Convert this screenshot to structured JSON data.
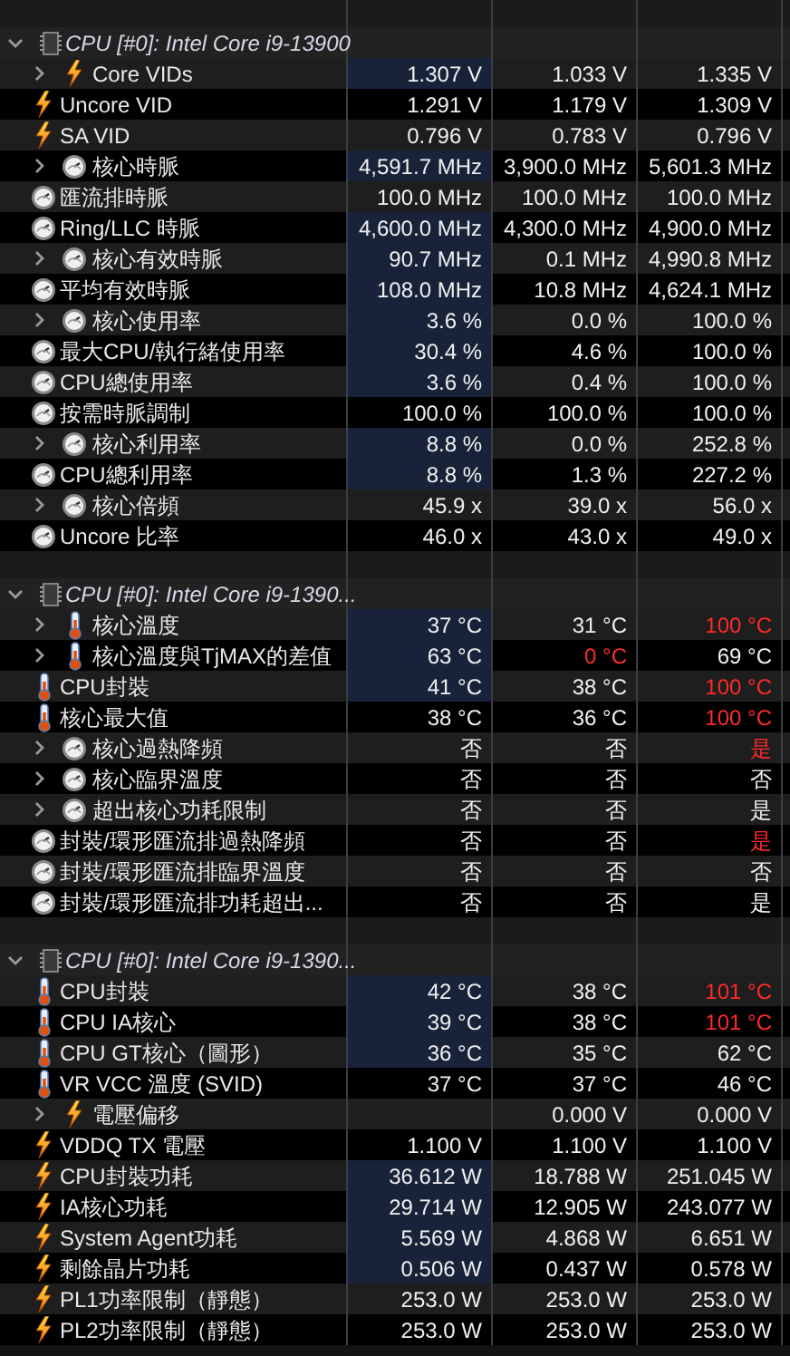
{
  "sections": [
    {
      "title": "CPU [#0]: Intel Core i9-13900",
      "expanded": true,
      "rows": [
        {
          "kind": "voltage",
          "label": "Core VIDs",
          "expandable": true,
          "highlighted": true,
          "current": {
            "text": "1.307 V",
            "alert": false
          },
          "minimum": {
            "text": "1.033 V",
            "alert": false
          },
          "maximum": {
            "text": "1.335 V",
            "alert": false
          }
        },
        {
          "kind": "voltage",
          "label": "Uncore VID",
          "expandable": false,
          "highlighted": false,
          "current": {
            "text": "1.291 V",
            "alert": false
          },
          "minimum": {
            "text": "1.179 V",
            "alert": false
          },
          "maximum": {
            "text": "1.309 V",
            "alert": false
          }
        },
        {
          "kind": "voltage",
          "label": "SA VID",
          "expandable": false,
          "highlighted": false,
          "current": {
            "text": "0.796 V",
            "alert": false
          },
          "minimum": {
            "text": "0.783 V",
            "alert": false
          },
          "maximum": {
            "text": "0.796 V",
            "alert": false
          }
        },
        {
          "kind": "clock",
          "label": "核心時脈",
          "expandable": true,
          "highlighted": true,
          "current": {
            "text": "4,591.7 MHz",
            "alert": false
          },
          "minimum": {
            "text": "3,900.0 MHz",
            "alert": false
          },
          "maximum": {
            "text": "5,601.3 MHz",
            "alert": false
          }
        },
        {
          "kind": "clock",
          "label": "匯流排時脈",
          "expandable": false,
          "highlighted": false,
          "current": {
            "text": "100.0 MHz",
            "alert": false
          },
          "minimum": {
            "text": "100.0 MHz",
            "alert": false
          },
          "maximum": {
            "text": "100.0 MHz",
            "alert": false
          }
        },
        {
          "kind": "clock",
          "label": "Ring/LLC 時脈",
          "expandable": false,
          "highlighted": true,
          "current": {
            "text": "4,600.0 MHz",
            "alert": false
          },
          "minimum": {
            "text": "4,300.0 MHz",
            "alert": false
          },
          "maximum": {
            "text": "4,900.0 MHz",
            "alert": false
          }
        },
        {
          "kind": "clock",
          "label": "核心有效時脈",
          "expandable": true,
          "highlighted": true,
          "current": {
            "text": "90.7 MHz",
            "alert": false
          },
          "minimum": {
            "text": "0.1 MHz",
            "alert": false
          },
          "maximum": {
            "text": "4,990.8 MHz",
            "alert": false
          }
        },
        {
          "kind": "clock",
          "label": "平均有效時脈",
          "expandable": false,
          "highlighted": true,
          "current": {
            "text": "108.0 MHz",
            "alert": false
          },
          "minimum": {
            "text": "10.8 MHz",
            "alert": false
          },
          "maximum": {
            "text": "4,624.1 MHz",
            "alert": false
          }
        },
        {
          "kind": "clock",
          "label": "核心使用率",
          "expandable": true,
          "highlighted": true,
          "current": {
            "text": "3.6 %",
            "alert": false
          },
          "minimum": {
            "text": "0.0 %",
            "alert": false
          },
          "maximum": {
            "text": "100.0 %",
            "alert": false
          }
        },
        {
          "kind": "clock",
          "label": "最大CPU/執行緒使用率",
          "expandable": false,
          "highlighted": true,
          "current": {
            "text": "30.4 %",
            "alert": false
          },
          "minimum": {
            "text": "4.6 %",
            "alert": false
          },
          "maximum": {
            "text": "100.0 %",
            "alert": false
          }
        },
        {
          "kind": "clock",
          "label": "CPU總使用率",
          "expandable": false,
          "highlighted": true,
          "current": {
            "text": "3.6 %",
            "alert": false
          },
          "minimum": {
            "text": "0.4 %",
            "alert": false
          },
          "maximum": {
            "text": "100.0 %",
            "alert": false
          }
        },
        {
          "kind": "clock",
          "label": "按需時脈調制",
          "expandable": false,
          "highlighted": false,
          "current": {
            "text": "100.0 %",
            "alert": false
          },
          "minimum": {
            "text": "100.0 %",
            "alert": false
          },
          "maximum": {
            "text": "100.0 %",
            "alert": false
          }
        },
        {
          "kind": "clock",
          "label": "核心利用率",
          "expandable": true,
          "highlighted": true,
          "current": {
            "text": "8.8 %",
            "alert": false
          },
          "minimum": {
            "text": "0.0 %",
            "alert": false
          },
          "maximum": {
            "text": "252.8 %",
            "alert": false
          }
        },
        {
          "kind": "clock",
          "label": "CPU總利用率",
          "expandable": false,
          "highlighted": true,
          "current": {
            "text": "8.8 %",
            "alert": false
          },
          "minimum": {
            "text": "1.3 %",
            "alert": false
          },
          "maximum": {
            "text": "227.2 %",
            "alert": false
          }
        },
        {
          "kind": "clock",
          "label": "核心倍頻",
          "expandable": true,
          "highlighted": false,
          "current": {
            "text": "45.9 x",
            "alert": false
          },
          "minimum": {
            "text": "39.0 x",
            "alert": false
          },
          "maximum": {
            "text": "56.0 x",
            "alert": false
          }
        },
        {
          "kind": "clock",
          "label": "Uncore 比率",
          "expandable": false,
          "highlighted": false,
          "current": {
            "text": "46.0 x",
            "alert": false
          },
          "minimum": {
            "text": "43.0 x",
            "alert": false
          },
          "maximum": {
            "text": "49.0 x",
            "alert": false
          }
        }
      ]
    },
    {
      "title": "CPU [#0]: Intel Core i9-1390...",
      "expanded": true,
      "rows": [
        {
          "kind": "temperature",
          "label": "核心溫度",
          "expandable": true,
          "highlighted": true,
          "current": {
            "text": "37 °C",
            "alert": false
          },
          "minimum": {
            "text": "31 °C",
            "alert": false
          },
          "maximum": {
            "text": "100 °C",
            "alert": true
          }
        },
        {
          "kind": "temperature",
          "label": "核心溫度與TjMAX的差值",
          "expandable": true,
          "highlighted": true,
          "current": {
            "text": "63 °C",
            "alert": false
          },
          "minimum": {
            "text": "0 °C",
            "alert": true
          },
          "maximum": {
            "text": "69 °C",
            "alert": false
          }
        },
        {
          "kind": "temperature",
          "label": "CPU封裝",
          "expandable": false,
          "highlighted": true,
          "current": {
            "text": "41 °C",
            "alert": false
          },
          "minimum": {
            "text": "38 °C",
            "alert": false
          },
          "maximum": {
            "text": "100 °C",
            "alert": true
          }
        },
        {
          "kind": "temperature",
          "label": "核心最大值",
          "expandable": false,
          "highlighted": false,
          "current": {
            "text": "38 °C",
            "alert": false
          },
          "minimum": {
            "text": "36 °C",
            "alert": false
          },
          "maximum": {
            "text": "100 °C",
            "alert": true
          }
        },
        {
          "kind": "clock",
          "label": "核心過熱降頻",
          "expandable": true,
          "highlighted": false,
          "current": {
            "text": "否",
            "alert": false
          },
          "minimum": {
            "text": "否",
            "alert": false
          },
          "maximum": {
            "text": "是",
            "alert": true
          }
        },
        {
          "kind": "clock",
          "label": "核心臨界溫度",
          "expandable": true,
          "highlighted": false,
          "current": {
            "text": "否",
            "alert": false
          },
          "minimum": {
            "text": "否",
            "alert": false
          },
          "maximum": {
            "text": "否",
            "alert": false
          }
        },
        {
          "kind": "clock",
          "label": "超出核心功耗限制",
          "expandable": true,
          "highlighted": false,
          "current": {
            "text": "否",
            "alert": false
          },
          "minimum": {
            "text": "否",
            "alert": false
          },
          "maximum": {
            "text": "是",
            "alert": false
          }
        },
        {
          "kind": "clock",
          "label": "封裝/環形匯流排過熱降頻",
          "expandable": false,
          "highlighted": false,
          "current": {
            "text": "否",
            "alert": false
          },
          "minimum": {
            "text": "否",
            "alert": false
          },
          "maximum": {
            "text": "是",
            "alert": true
          }
        },
        {
          "kind": "clock",
          "label": "封裝/環形匯流排臨界溫度",
          "expandable": false,
          "highlighted": false,
          "current": {
            "text": "否",
            "alert": false
          },
          "minimum": {
            "text": "否",
            "alert": false
          },
          "maximum": {
            "text": "否",
            "alert": false
          }
        },
        {
          "kind": "clock",
          "label": "封裝/環形匯流排功耗超出...",
          "expandable": false,
          "highlighted": false,
          "current": {
            "text": "否",
            "alert": false
          },
          "minimum": {
            "text": "否",
            "alert": false
          },
          "maximum": {
            "text": "是",
            "alert": false
          }
        }
      ]
    },
    {
      "title": "CPU [#0]: Intel Core i9-1390...",
      "expanded": true,
      "rows": [
        {
          "kind": "temperature",
          "label": "CPU封裝",
          "expandable": false,
          "highlighted": true,
          "current": {
            "text": "42 °C",
            "alert": false
          },
          "minimum": {
            "text": "38 °C",
            "alert": false
          },
          "maximum": {
            "text": "101 °C",
            "alert": true
          }
        },
        {
          "kind": "temperature",
          "label": "CPU IA核心",
          "expandable": false,
          "highlighted": true,
          "current": {
            "text": "39 °C",
            "alert": false
          },
          "minimum": {
            "text": "38 °C",
            "alert": false
          },
          "maximum": {
            "text": "101 °C",
            "alert": true
          }
        },
        {
          "kind": "temperature",
          "label": "CPU GT核心（圖形）",
          "expandable": false,
          "highlighted": true,
          "current": {
            "text": "36 °C",
            "alert": false
          },
          "minimum": {
            "text": "35 °C",
            "alert": false
          },
          "maximum": {
            "text": "62 °C",
            "alert": false
          }
        },
        {
          "kind": "temperature",
          "label": "VR VCC 溫度 (SVID)",
          "expandable": false,
          "highlighted": false,
          "current": {
            "text": "37 °C",
            "alert": false
          },
          "minimum": {
            "text": "37 °C",
            "alert": false
          },
          "maximum": {
            "text": "46 °C",
            "alert": false
          }
        },
        {
          "kind": "voltage",
          "label": "電壓偏移",
          "expandable": true,
          "highlighted": false,
          "minimum": {
            "text": "0.000 V",
            "alert": false
          },
          "maximum": {
            "text": "0.000 V",
            "alert": false
          }
        },
        {
          "kind": "voltage",
          "label": "VDDQ TX 電壓",
          "expandable": false,
          "highlighted": false,
          "current": {
            "text": "1.100 V",
            "alert": false
          },
          "minimum": {
            "text": "1.100 V",
            "alert": false
          },
          "maximum": {
            "text": "1.100 V",
            "alert": false
          }
        },
        {
          "kind": "voltage",
          "label": "CPU封裝功耗",
          "expandable": false,
          "highlighted": true,
          "current": {
            "text": "36.612 W",
            "alert": false
          },
          "minimum": {
            "text": "18.788 W",
            "alert": false
          },
          "maximum": {
            "text": "251.045 W",
            "alert": false
          }
        },
        {
          "kind": "voltage",
          "label": "IA核心功耗",
          "expandable": false,
          "highlighted": true,
          "current": {
            "text": "29.714 W",
            "alert": false
          },
          "minimum": {
            "text": "12.905 W",
            "alert": false
          },
          "maximum": {
            "text": "243.077 W",
            "alert": false
          }
        },
        {
          "kind": "voltage",
          "label": "System Agent功耗",
          "expandable": false,
          "highlighted": true,
          "current": {
            "text": "5.569 W",
            "alert": false
          },
          "minimum": {
            "text": "4.868 W",
            "alert": false
          },
          "maximum": {
            "text": "6.651 W",
            "alert": false
          }
        },
        {
          "kind": "voltage",
          "label": "剩餘晶片功耗",
          "expandable": false,
          "highlighted": true,
          "current": {
            "text": "0.506 W",
            "alert": false
          },
          "minimum": {
            "text": "0.437 W",
            "alert": false
          },
          "maximum": {
            "text": "0.578 W",
            "alert": false
          }
        },
        {
          "kind": "voltage",
          "label": "PL1功率限制（靜態）",
          "expandable": false,
          "highlighted": false,
          "current": {
            "text": "253.0 W",
            "alert": false
          },
          "minimum": {
            "text": "253.0 W",
            "alert": false
          },
          "maximum": {
            "text": "253.0 W",
            "alert": false
          }
        },
        {
          "kind": "voltage",
          "label": "PL2功率限制（靜態）",
          "expandable": false,
          "highlighted": false,
          "current": {
            "text": "253.0 W",
            "alert": false
          },
          "minimum": {
            "text": "253.0 W",
            "alert": false
          },
          "maximum": {
            "text": "253.0 W",
            "alert": false
          }
        }
      ]
    }
  ]
}
